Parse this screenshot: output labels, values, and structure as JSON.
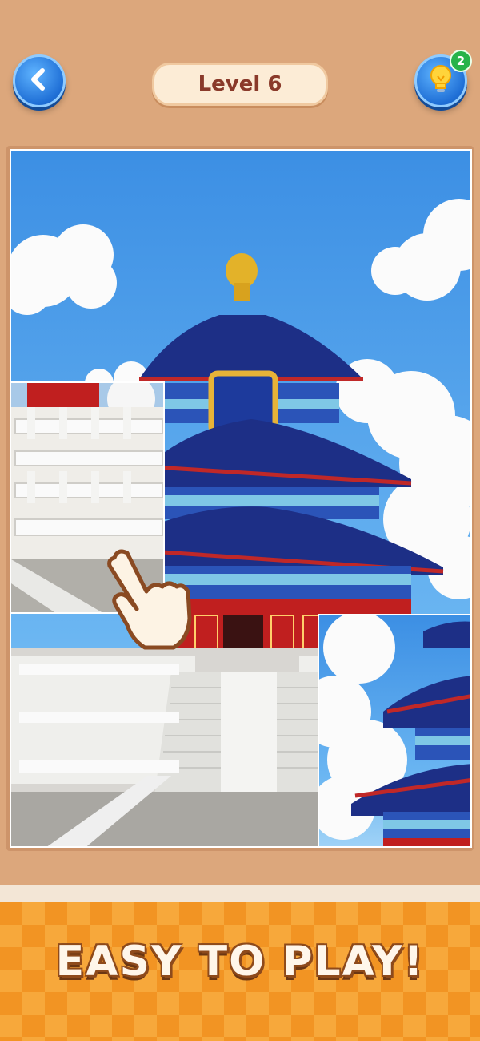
{
  "header": {
    "level_label": "Level 6",
    "back_icon": "chevron-left-icon",
    "hint_icon": "lightbulb-icon",
    "hint_count": "2"
  },
  "puzzle": {
    "subject": "Temple of Heaven yarn craft scene",
    "hand_icon": "tap-hand-icon"
  },
  "footer": {
    "headline": "EASY TO PLAY!"
  },
  "colors": {
    "accent_blue": "#1f6fd6",
    "board_brown": "#cd946a",
    "banner_orange": "#f29423",
    "level_text": "#8a3a2a",
    "badge_green": "#27b34a"
  }
}
